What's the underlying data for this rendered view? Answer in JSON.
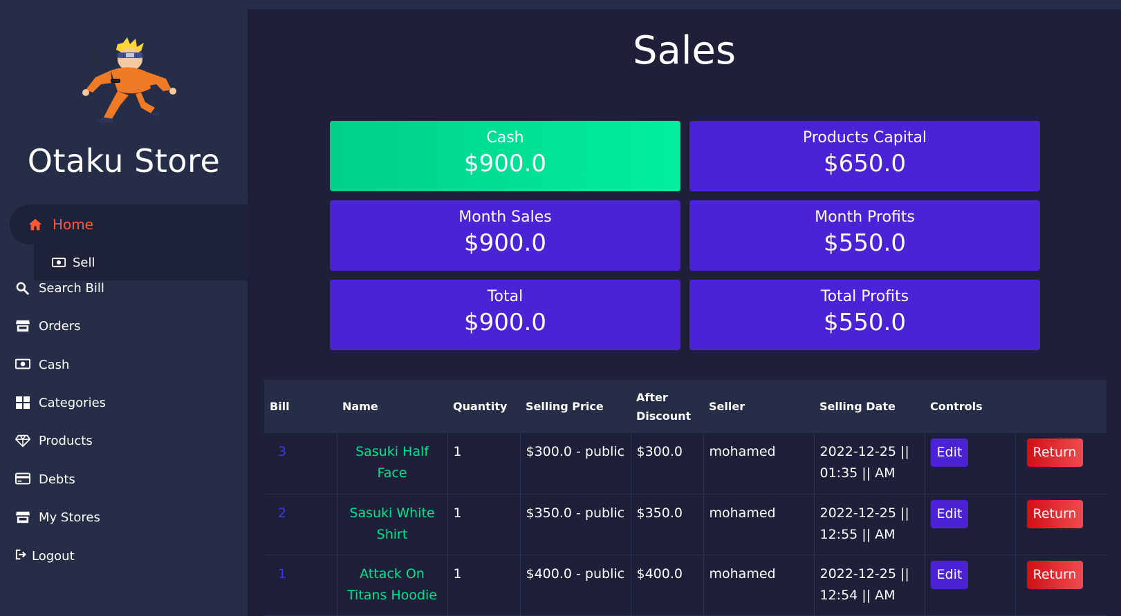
{
  "sidebar": {
    "brand": "Otaku Store",
    "home": "Home",
    "sell": "Sell",
    "items": [
      {
        "label": "Search Bill",
        "icon": "search-icon"
      },
      {
        "label": "Orders",
        "icon": "store-icon"
      },
      {
        "label": "Cash",
        "icon": "money-bill-icon"
      },
      {
        "label": "Categories",
        "icon": "grid-icon"
      },
      {
        "label": "Products",
        "icon": "diamond-icon"
      },
      {
        "label": "Debts",
        "icon": "credit-card-icon"
      },
      {
        "label": "My Stores",
        "icon": "store-icon"
      },
      {
        "label": "Logout",
        "icon": "logout-icon"
      }
    ]
  },
  "main": {
    "title": "Sales",
    "cards": [
      {
        "label": "Cash",
        "value": "$900.0"
      },
      {
        "label": "Products Capital",
        "value": "$650.0"
      },
      {
        "label": "Month Sales",
        "value": "$900.0"
      },
      {
        "label": "Month Profits",
        "value": "$550.0"
      },
      {
        "label": "Total",
        "value": "$900.0"
      },
      {
        "label": "Total Profits",
        "value": "$550.0"
      }
    ],
    "table": {
      "headers": {
        "bill": "Bill",
        "name": "Name",
        "quantity": "Quantity",
        "selling_price": "Selling Price",
        "after_discount_1": "After",
        "after_discount_2": "Discount",
        "seller": "Seller",
        "selling_date": "Selling Date",
        "controls": "Controls"
      },
      "edit_label": "Edit",
      "return_label": "Return",
      "rows": [
        {
          "bill": "3",
          "name": "Sasuki Half Face",
          "quantity": "1",
          "price": "$300.0 - public",
          "after": "$300.0",
          "seller": "mohamed",
          "date": "2022-12-25 || 01:35 || AM"
        },
        {
          "bill": "2",
          "name": "Sasuki White Shirt",
          "quantity": "1",
          "price": "$350.0 - public",
          "after": "$350.0",
          "seller": "mohamed",
          "date": "2022-12-25 || 12:55 || AM"
        },
        {
          "bill": "1",
          "name": "Attack On Titans Hoodie",
          "quantity": "1",
          "price": "$400.0 - public",
          "after": "$400.0",
          "seller": "mohamed",
          "date": "2022-12-25 || 12:54 || AM"
        }
      ]
    }
  },
  "colors": {
    "accent": "#4b22d6",
    "cash_card": "#00e39a",
    "home_active": "#ff5a36",
    "name_link": "#00e38c",
    "bill_link": "#3a37ee",
    "return_button": "#e0262c"
  }
}
